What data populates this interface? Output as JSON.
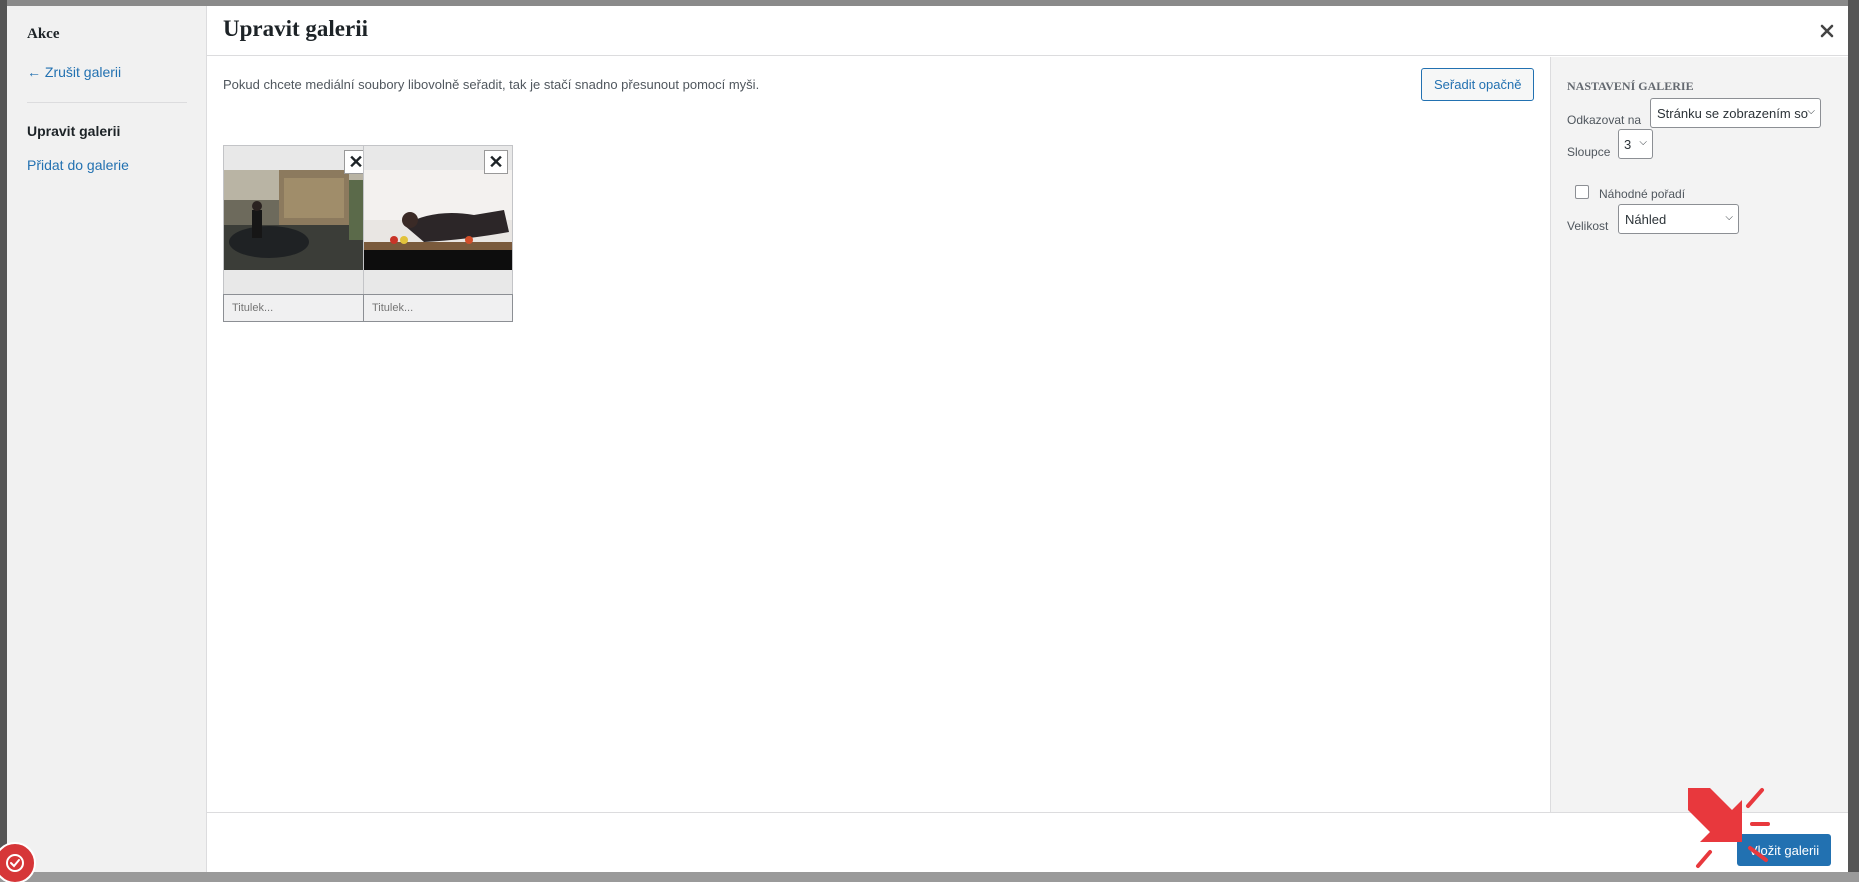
{
  "menu": {
    "title": "Akce",
    "cancel": "← Zrušit galerii",
    "items": [
      {
        "label": "Upravit galerii"
      },
      {
        "label": "Přidat do galerie"
      }
    ]
  },
  "frame": {
    "title": "Upravit galerii",
    "close_icon": "close-icon"
  },
  "content": {
    "instructions": "Pokud chcete mediální soubory libovolně seřadit, tak je stačí snadno přesunout pomocí myši.",
    "reverse_button": "Seřadit opačně",
    "attachments": [
      {
        "caption_placeholder": "Titulek..."
      },
      {
        "caption_placeholder": "Titulek..."
      }
    ]
  },
  "sidebar": {
    "heading": "Nastavení galerie",
    "link_to_label": "Odkazovat na",
    "link_to_value": "Stránku se zobrazením so",
    "columns_label": "Sloupce",
    "columns_value": "3",
    "random_order_label": "Náhodné pořadí",
    "size_label": "Velikost",
    "size_value": "Náhled"
  },
  "toolbar": {
    "insert_button": "Vložit galerii"
  },
  "colors": {
    "accent": "#2271b1",
    "highlight": "#e8383d"
  }
}
